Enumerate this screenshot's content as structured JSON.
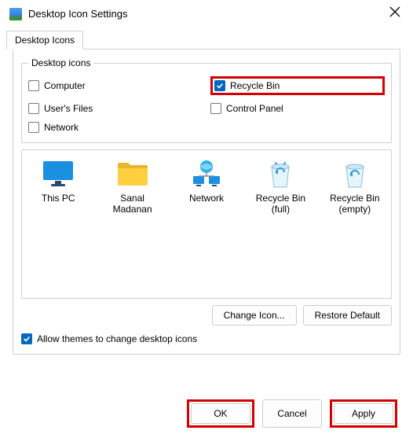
{
  "title": "Desktop Icon Settings",
  "tabLabel": "Desktop Icons",
  "fieldsetLabel": "Desktop icons",
  "checks": {
    "computer": {
      "label": "Computer",
      "checked": false
    },
    "recycleBin": {
      "label": "Recycle Bin",
      "checked": true
    },
    "usersFiles": {
      "label": "User's Files",
      "checked": false
    },
    "controlPanel": {
      "label": "Control Panel",
      "checked": false
    },
    "network": {
      "label": "Network",
      "checked": false
    }
  },
  "icons": [
    {
      "name": "This PC"
    },
    {
      "name": "Sanal Madanan"
    },
    {
      "name": "Network"
    },
    {
      "name": "Recycle Bin (full)"
    },
    {
      "name": "Recycle Bin (empty)"
    }
  ],
  "buttons": {
    "changeIcon": "Change Icon...",
    "restore": "Restore Default",
    "ok": "OK",
    "cancel": "Cancel",
    "apply": "Apply"
  },
  "allowThemes": {
    "label": "Allow themes to change desktop icons",
    "checked": true
  }
}
